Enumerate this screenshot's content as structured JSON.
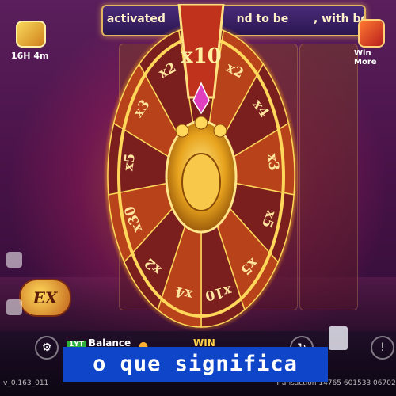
{
  "banner": {
    "part1": "activated",
    "part2": "nd to be",
    "part3": ", with both"
  },
  "corner_left": {
    "label": "16H 4m",
    "icon": "gift-icon"
  },
  "corner_right": {
    "label": "Win More",
    "icon": "chest-icon"
  },
  "wheel": {
    "segments": [
      "x10",
      "x2",
      "x4",
      "x3",
      "x5",
      "x5",
      "x10",
      "x4",
      "x2",
      "x30",
      "x5",
      "x3",
      "x2"
    ],
    "center_icon": "jester-mask-icon",
    "colors": {
      "rim": "#f2a020",
      "dark": "#7a1e1e",
      "mid": "#b8431a",
      "gold": "#ffd75a"
    }
  },
  "badge": {
    "text": "EX"
  },
  "bottom": {
    "balance_tag": "1YT",
    "balance_label": "Balance",
    "win_label": "WIN",
    "footer_left": "v_0.163_011",
    "footer_right": "Transaction 14765 601533 0670213"
  },
  "caption": {
    "text": "o que significa"
  }
}
